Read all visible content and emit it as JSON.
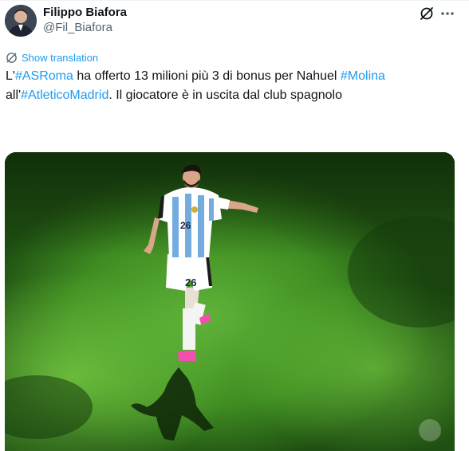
{
  "author": {
    "display_name": "Filippo Biafora",
    "handle": "@Fil_Biafora",
    "avatar": "person-avatar"
  },
  "actions": {
    "grok_icon": "slashed-circle-icon",
    "more_icon": "more-dots-icon"
  },
  "translation": {
    "label": "Show translation",
    "icon": "globe-icon"
  },
  "tweet": {
    "segments": [
      {
        "text": "L'",
        "type": "text"
      },
      {
        "text": "#ASRoma",
        "type": "hashtag"
      },
      {
        "text": " ha offerto 13 milioni più 3 di bonus per Nahuel ",
        "type": "text"
      },
      {
        "text": "#Molina",
        "type": "hashtag"
      },
      {
        "text": " all'",
        "type": "text"
      },
      {
        "text": "#AtleticoMadrid",
        "type": "hashtag"
      },
      {
        "text": ". Il giocatore è in uscita dal club spagnolo",
        "type": "text"
      }
    ]
  },
  "media": {
    "kind": "photo",
    "jersey_number": "26"
  },
  "colors": {
    "link": "#1d9bf0",
    "text": "#0f1419",
    "muted": "#536471"
  }
}
